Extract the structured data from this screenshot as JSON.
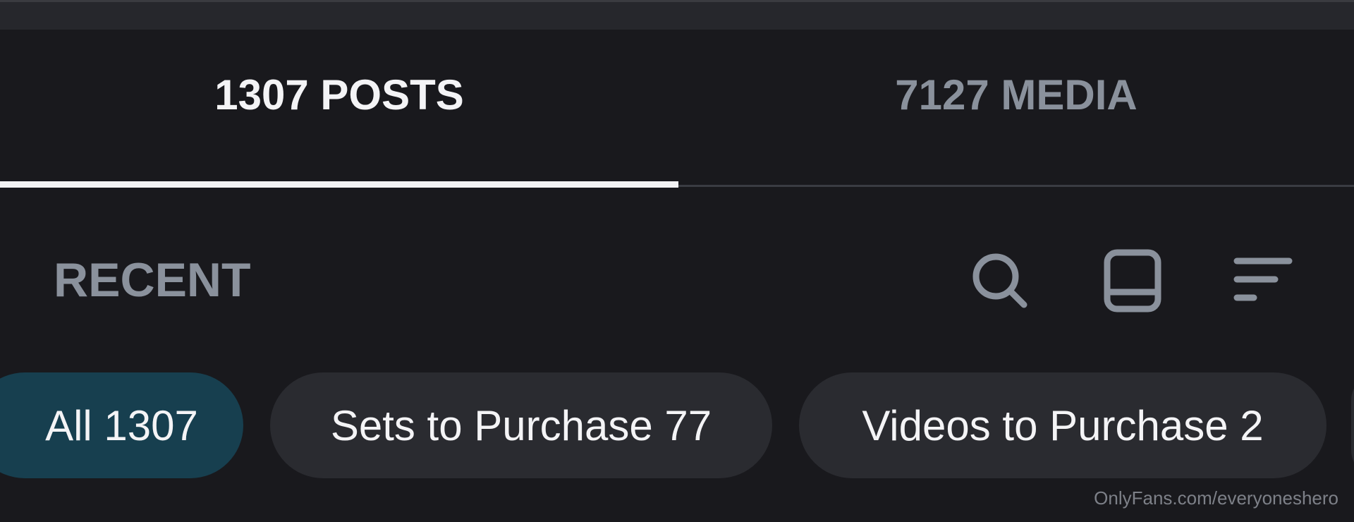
{
  "tabs": {
    "posts": "1307 POSTS",
    "media": "7127 MEDIA",
    "active": "posts"
  },
  "sort": {
    "label": "RECENT",
    "icons": [
      "search-icon",
      "layout-icon",
      "filter-icon"
    ]
  },
  "chips": {
    "all": "All 1307",
    "sets": "Sets to Purchase 77",
    "videos": "Videos to Purchase 2"
  },
  "watermark": "OnlyFans.com/everyoneshero",
  "colors": {
    "background": "#19191d",
    "active_tab": "#f4f4f6",
    "inactive_tab": "#8a919c",
    "active_chip": "#173f4f",
    "chip": "#2a2b30"
  }
}
